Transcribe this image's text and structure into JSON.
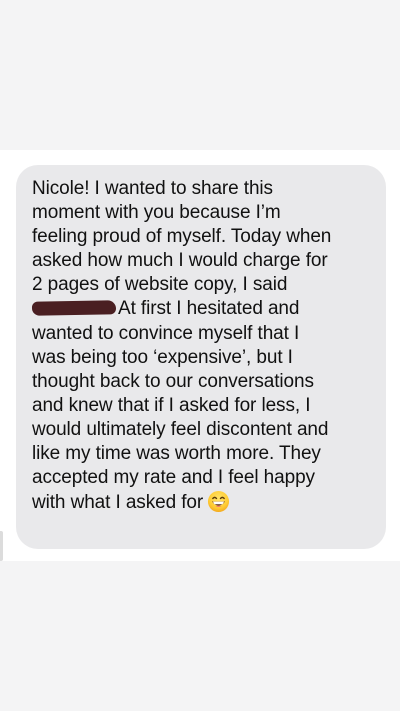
{
  "message": {
    "lines": [
      "Nicole! I wanted to share this",
      "moment with you because I’m",
      "feeling proud of myself. Today when",
      "asked how much I would charge for",
      "2 pages of website copy, I said",
      "At first I hesitated and",
      "wanted to convince myself that I",
      "was being too ‘expensive’, but I",
      "thought back to our conversations",
      "and knew that if I asked for less, I",
      "would ultimately feel discontent and",
      "like my time was worth more. They",
      "accepted my rate and I feel happy",
      "with what I asked for"
    ],
    "redaction_color": "#4a1f22",
    "bubble_color": "#e9e9eb",
    "emoji": "grinning-face-with-smiling-eyes"
  }
}
